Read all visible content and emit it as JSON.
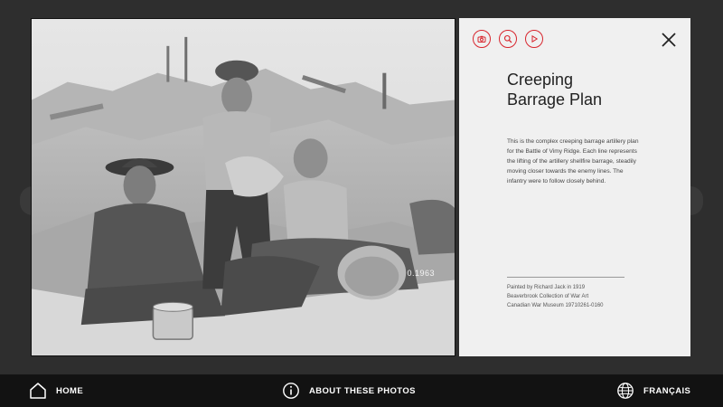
{
  "photo": {
    "caption": "0.1963"
  },
  "panel": {
    "tools": [
      {
        "icon": "camera-icon"
      },
      {
        "icon": "magnify-icon"
      },
      {
        "icon": "play-icon"
      }
    ],
    "title_line1": "Creeping",
    "title_line2": "Barrage Plan",
    "description": "This is the complex creeping barrage artillery plan for the Battle of Vimy Ridge. Each line represents the lifting of the artillery shellfire barrage, steadily moving closer towards the enemy lines. The infantry were to follow closely behind.",
    "credits": [
      "Painted by Richard Jack in 1919",
      "Beaverbrook Collection of War Art",
      "Canadian War Museum 19710261-0160"
    ],
    "accent_color": "#d8262e"
  },
  "footer": {
    "home_label": "HOME",
    "about_label": "ABOUT THESE PHOTOS",
    "language_label": "FRANÇAIS"
  }
}
